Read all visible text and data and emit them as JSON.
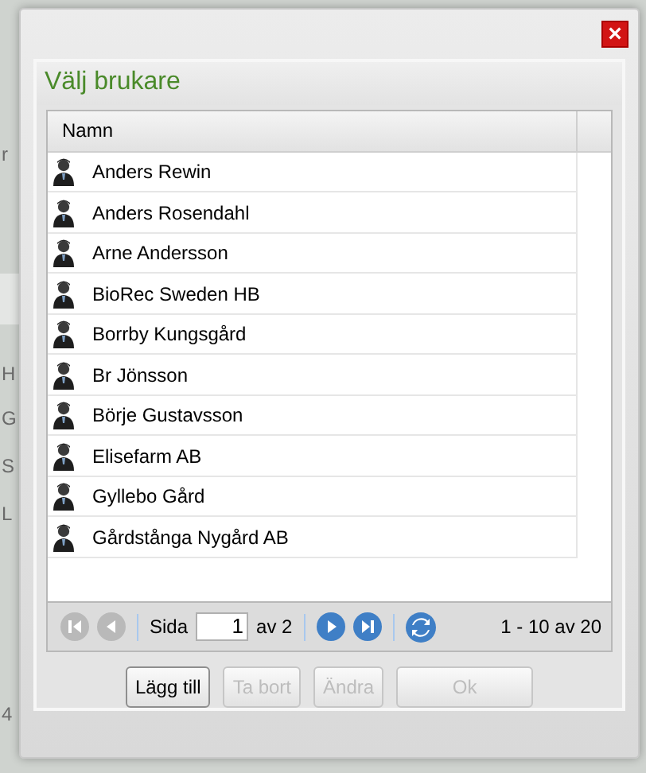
{
  "background_page": {
    "fragments": [
      "r",
      "H",
      "G",
      "S",
      "L",
      "4"
    ]
  },
  "dialog": {
    "title": "Välj brukare",
    "close": "×",
    "grid": {
      "columns": [
        "Namn"
      ],
      "rows": [
        {
          "name": "Anders Rewin",
          "selected": false
        },
        {
          "name": "Anders Rosendahl",
          "selected": false
        },
        {
          "name": "Arne Andersson",
          "selected": false
        },
        {
          "name": "BioRec Sweden HB",
          "selected": false
        },
        {
          "name": "Borrby Kungsgård",
          "selected": false
        },
        {
          "name": "Br Jönsson",
          "selected": false
        },
        {
          "name": "Börje Gustavsson",
          "selected": false
        },
        {
          "name": "Elisefarm AB",
          "selected": false
        },
        {
          "name": "Gyllebo Gård",
          "selected": false
        },
        {
          "name": "Gårdstånga Nygård AB",
          "selected": false
        }
      ]
    },
    "pager": {
      "first_disabled": true,
      "prev_disabled": true,
      "page_label": "Sida",
      "page": "1",
      "of": "av 2",
      "next_disabled": false,
      "last_disabled": false,
      "summary": "1 - 10 av 20"
    },
    "buttons": [
      {
        "label": "Lägg till",
        "disabled": false
      },
      {
        "label": "Ta bort",
        "disabled": true
      },
      {
        "label": "Ändra",
        "disabled": true
      },
      {
        "label": "Ok",
        "disabled": true,
        "wide": true
      }
    ]
  }
}
